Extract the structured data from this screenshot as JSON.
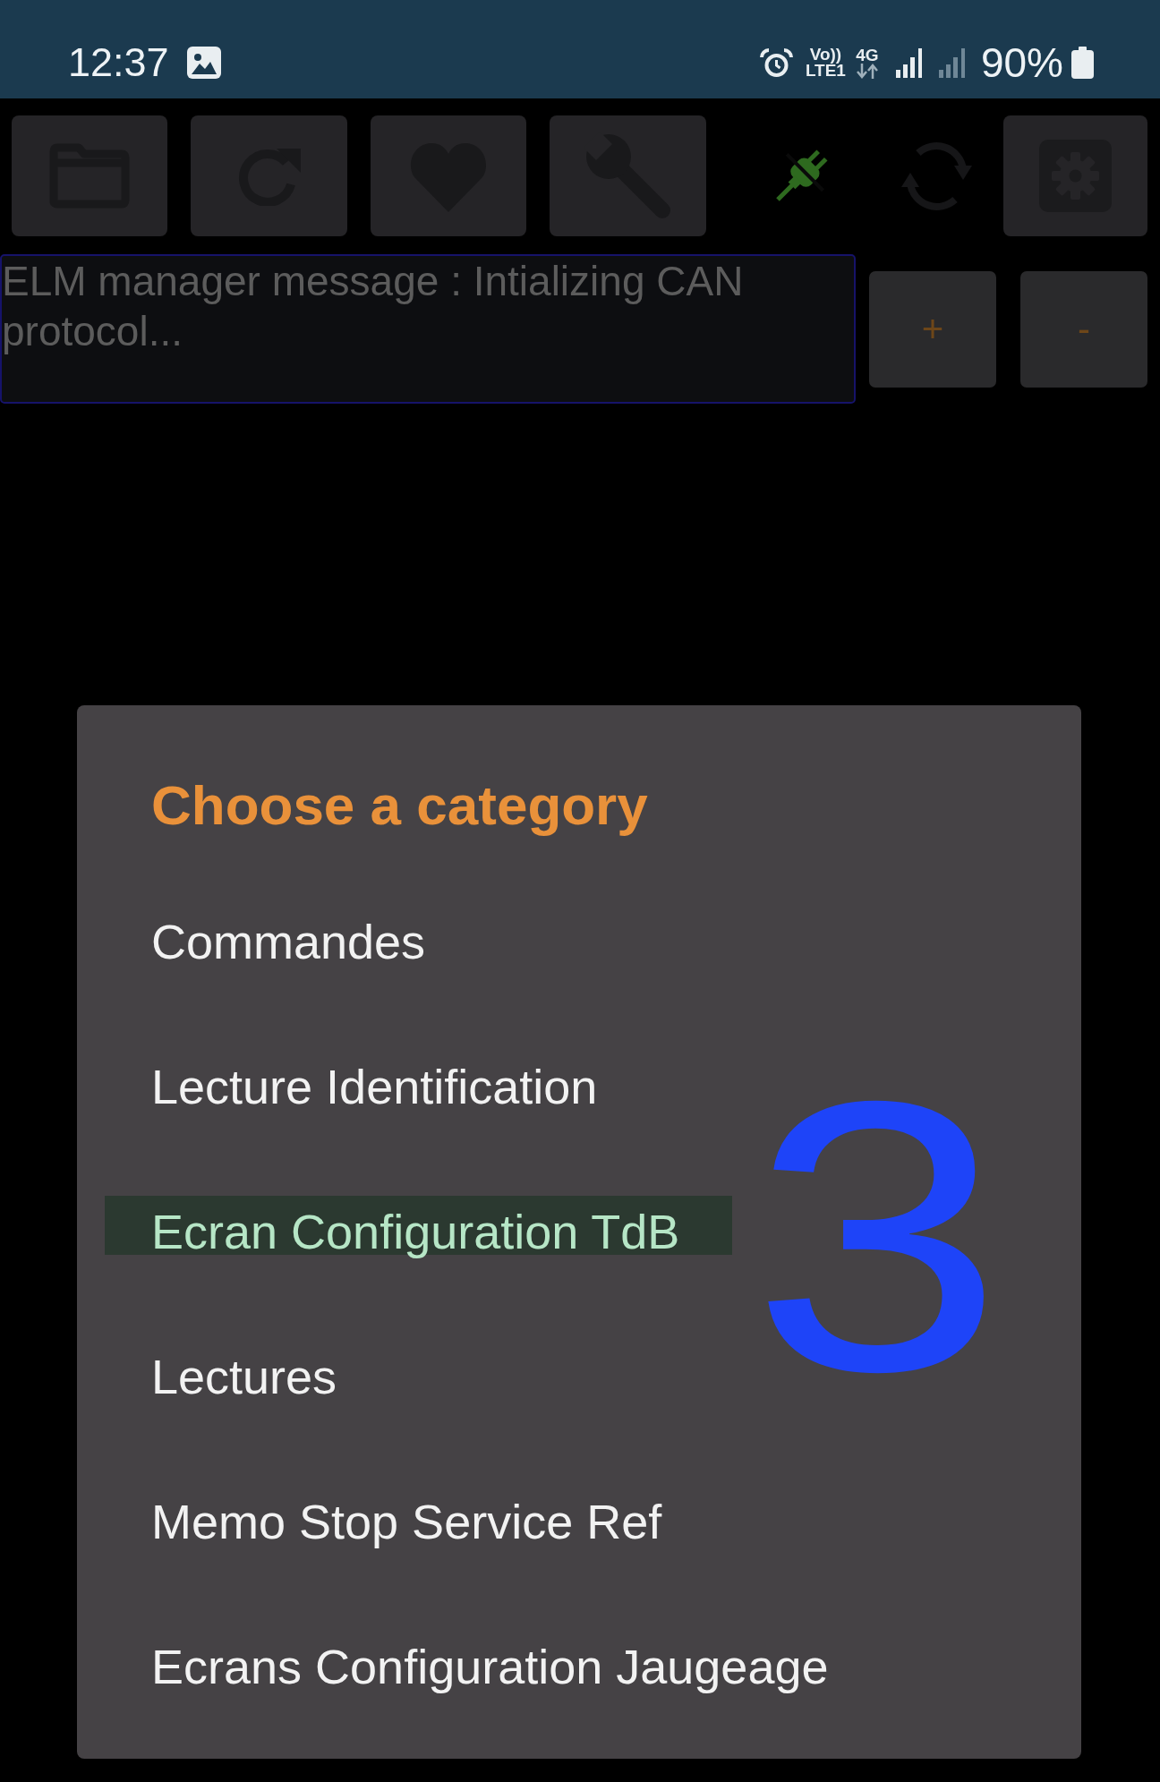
{
  "status_bar": {
    "time": "12:37",
    "volte_label": "Vo))",
    "lte_label": "LTE1",
    "network_type": "4G",
    "battery": "90%"
  },
  "message": {
    "text": "ELM manager message : Intializing CAN protocol..."
  },
  "side_buttons": [
    {
      "label": "+"
    },
    {
      "label": "-"
    }
  ],
  "dialog": {
    "title": "Choose a category",
    "items": [
      {
        "label": "Commandes",
        "selected": false
      },
      {
        "label": "Lecture Identification",
        "selected": false
      },
      {
        "label": "Ecran Configuration TdB",
        "selected": true
      },
      {
        "label": "Lectures",
        "selected": false
      },
      {
        "label": "Memo Stop Service Ref",
        "selected": false
      },
      {
        "label": "Ecrans Configuration Jaugeage",
        "selected": false
      }
    ]
  },
  "annotation": {
    "text": "3"
  }
}
